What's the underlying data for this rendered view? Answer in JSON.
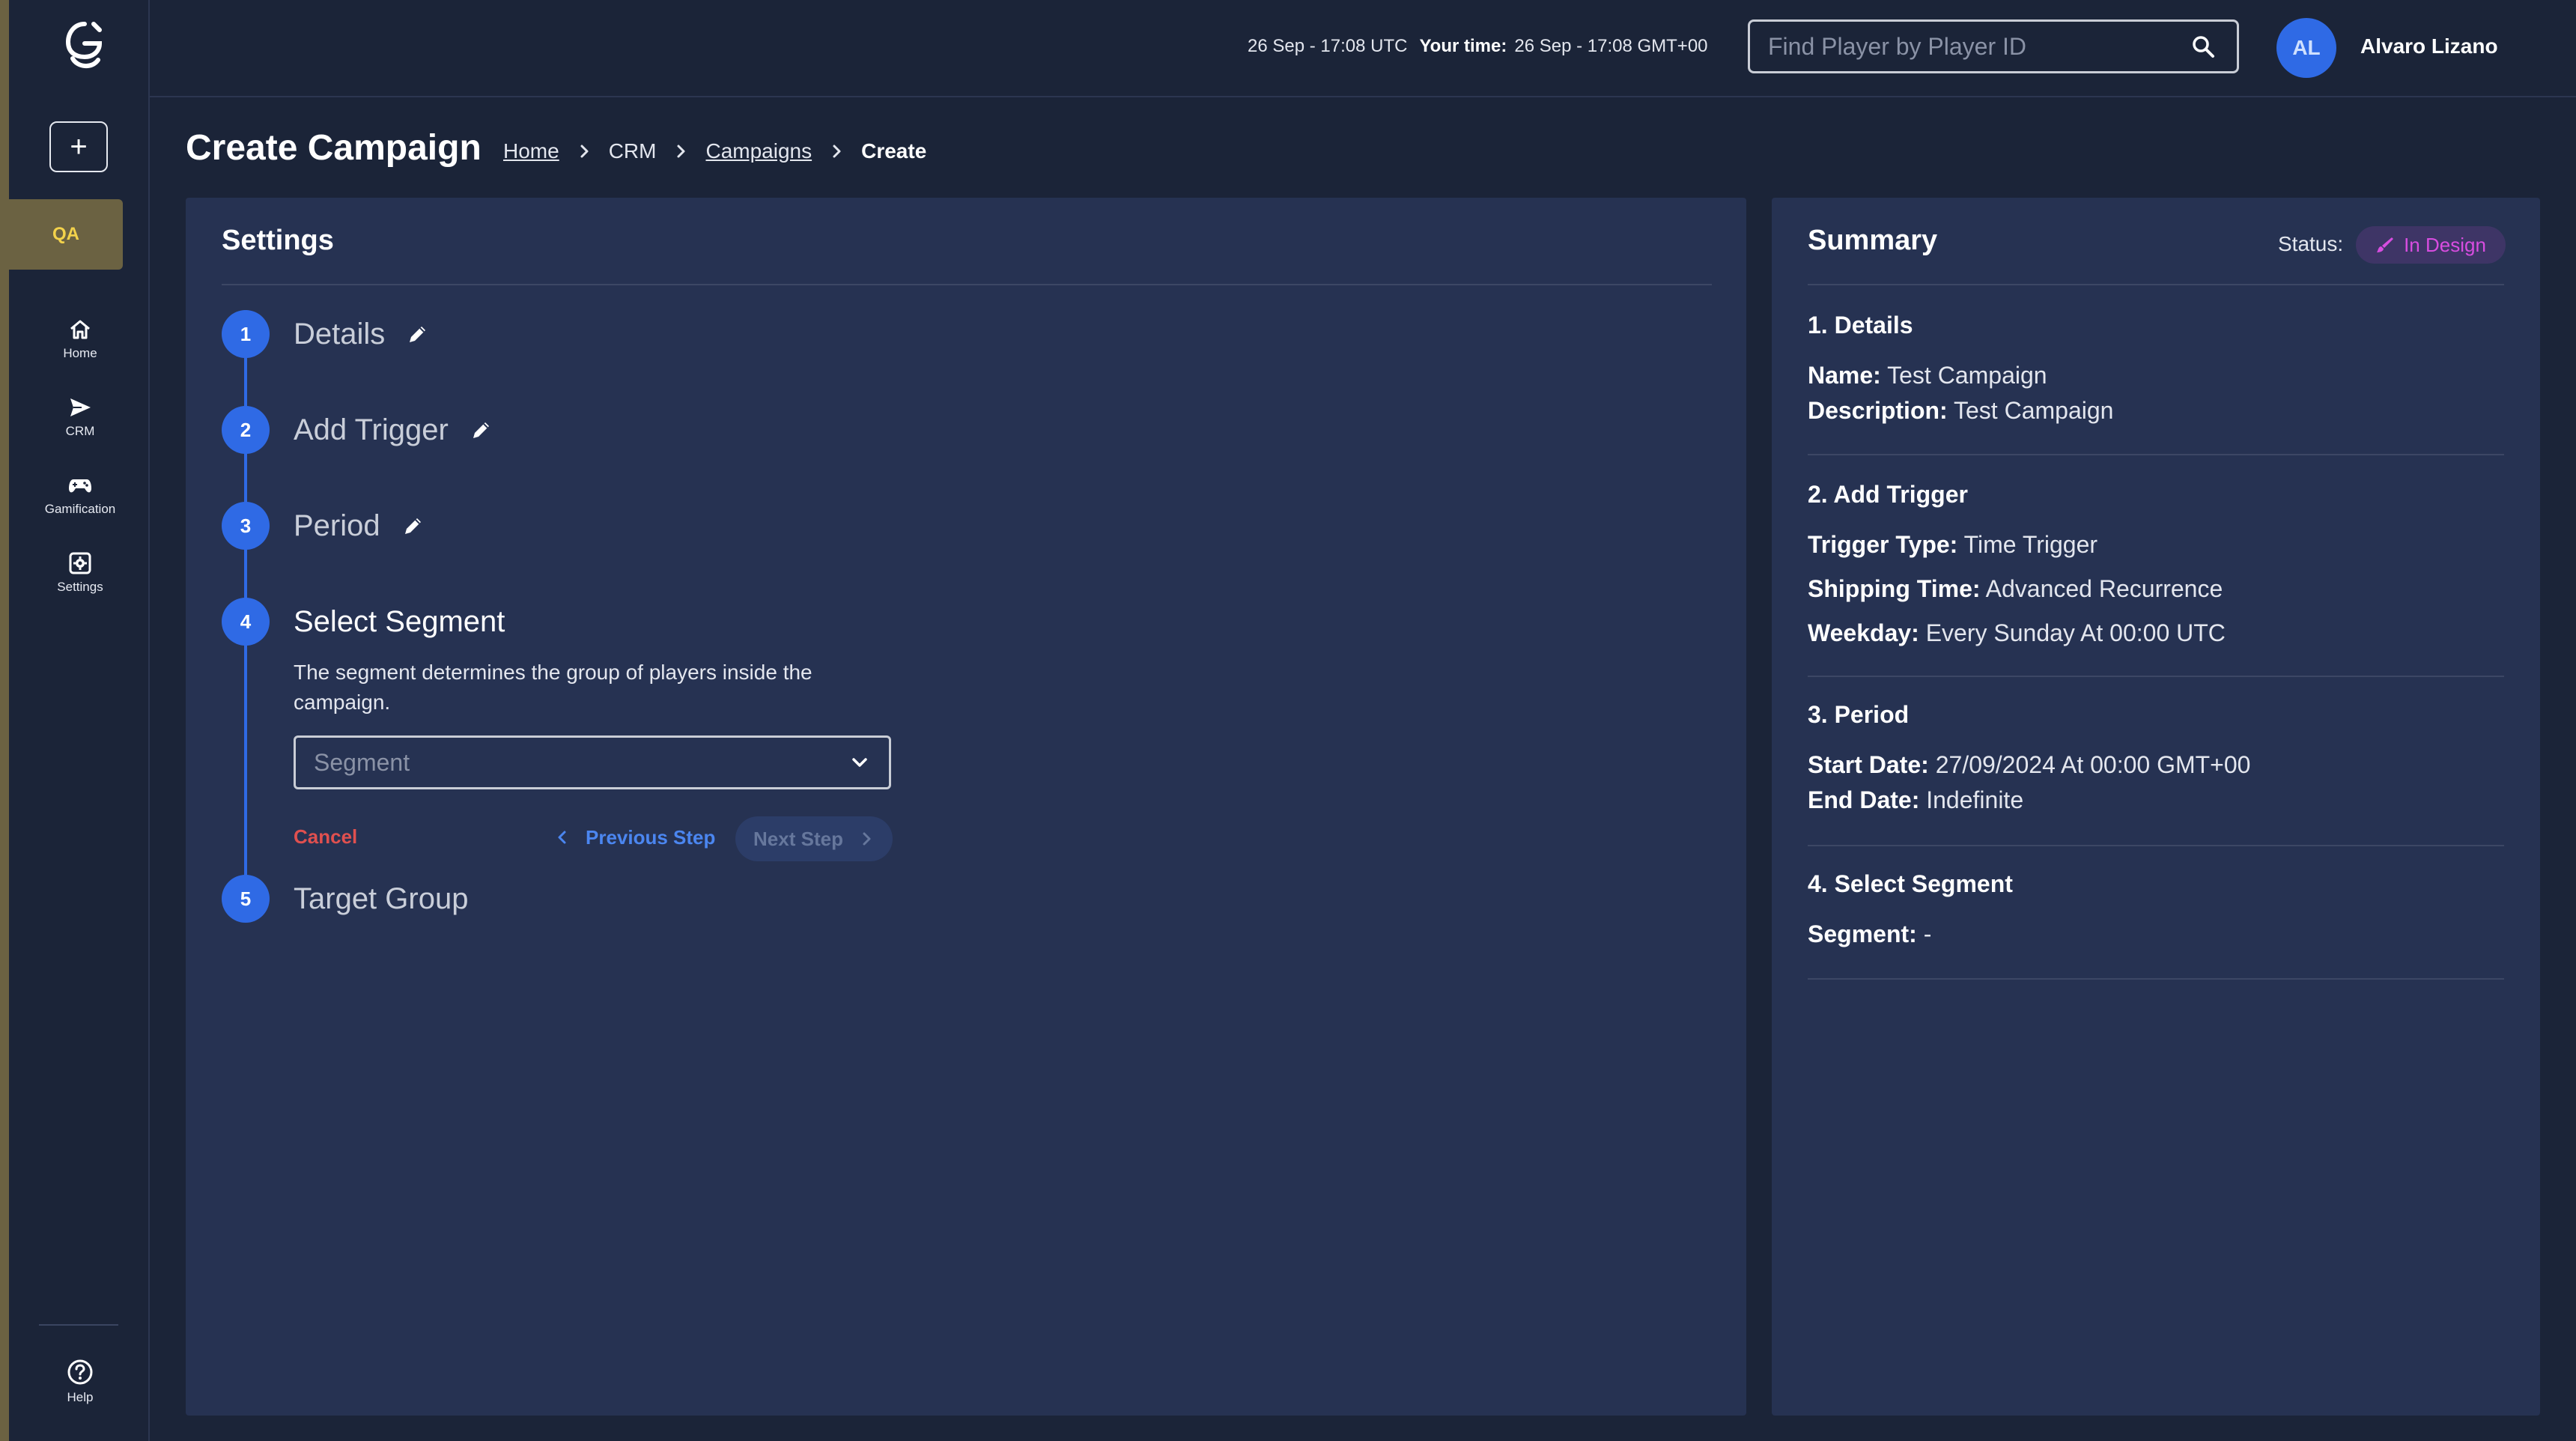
{
  "sidebar": {
    "env_label": "QA",
    "add_label": "+",
    "nav": [
      {
        "label": "Home",
        "icon": "home-icon"
      },
      {
        "label": "CRM",
        "icon": "send-icon"
      },
      {
        "label": "Gamification",
        "icon": "gamepad-icon"
      },
      {
        "label": "Settings",
        "icon": "settings-icon"
      }
    ],
    "help_label": "Help"
  },
  "topbar": {
    "server_time": "26 Sep - 17:08 UTC",
    "your_time_label": "Your time:",
    "your_time": "26 Sep - 17:08 GMT+00",
    "search_placeholder": "Find Player by Player ID",
    "avatar_initials": "AL",
    "user_name": "Alvaro Lizano"
  },
  "page": {
    "title": "Create Campaign",
    "breadcrumb": [
      "Home",
      "CRM",
      "Campaigns",
      "Create"
    ]
  },
  "settings": {
    "title": "Settings",
    "steps": [
      {
        "num": "1",
        "name": "Details"
      },
      {
        "num": "2",
        "name": "Add Trigger"
      },
      {
        "num": "3",
        "name": "Period"
      },
      {
        "num": "4",
        "name": "Select Segment"
      },
      {
        "num": "5",
        "name": "Target Group"
      }
    ],
    "segment_description": "The segment determines the group of players inside the campaign.",
    "segment_placeholder": "Segment",
    "cancel_label": "Cancel",
    "prev_label": "Previous Step",
    "next_label": "Next Step"
  },
  "summary": {
    "title": "Summary",
    "status_label": "Status:",
    "status_value": "In Design",
    "colors": {
      "accent": "#2f6ae5",
      "status": "#d84de0",
      "cancel": "#e0504f"
    },
    "sections": [
      {
        "heading": "1. Details",
        "lines": [
          {
            "label": "Name:",
            "value": "Test Campaign"
          },
          {
            "label": "Description:",
            "value": "Test Campaign"
          }
        ]
      },
      {
        "heading": "2. Add Trigger",
        "lines": [
          {
            "label": "Trigger Type:",
            "value": "Time Trigger"
          },
          {
            "label": "Shipping Time:",
            "value": "Advanced Recurrence"
          },
          {
            "label": "Weekday:",
            "value": "Every Sunday At 00:00 UTC"
          }
        ]
      },
      {
        "heading": "3. Period",
        "lines": [
          {
            "label": "Start Date:",
            "value": "27/09/2024 At 00:00 GMT+00"
          },
          {
            "label": "End Date:",
            "value": "Indefinite"
          }
        ]
      },
      {
        "heading": "4. Select Segment",
        "lines": [
          {
            "label": "Segment:",
            "value": "-"
          }
        ]
      }
    ]
  }
}
